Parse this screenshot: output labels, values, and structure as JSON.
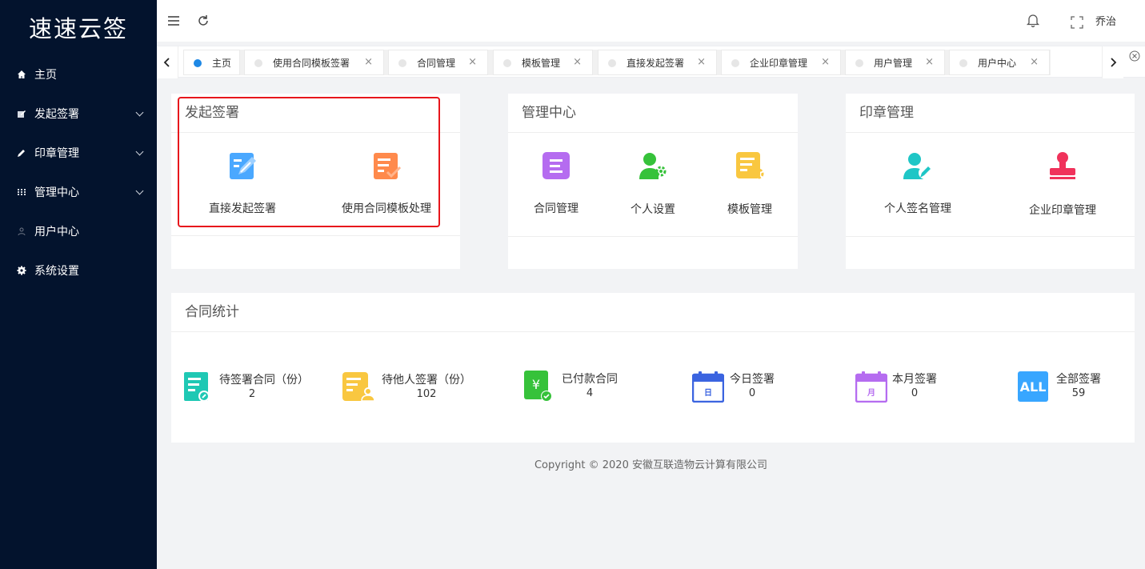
{
  "app": {
    "logo": "速速云签"
  },
  "sidebar": {
    "items": [
      {
        "label": "主页",
        "icon": "home-icon"
      },
      {
        "label": "发起签署",
        "icon": "edit-icon"
      },
      {
        "label": "印章管理",
        "icon": "pen-icon"
      },
      {
        "label": "管理中心",
        "icon": "grid-icon"
      },
      {
        "label": "用户中心",
        "icon": "user-icon"
      },
      {
        "label": "系统设置",
        "icon": "gear-icon"
      }
    ]
  },
  "header": {
    "user_name": "乔治"
  },
  "tabs": [
    {
      "label": "主页",
      "active": true
    },
    {
      "label": "使用合同模板签署"
    },
    {
      "label": "合同管理"
    },
    {
      "label": "模板管理"
    },
    {
      "label": "直接发起签署"
    },
    {
      "label": "企业印章管理"
    },
    {
      "label": "用户管理"
    },
    {
      "label": "用户中心"
    }
  ],
  "cards": {
    "sign": {
      "title": "发起签署",
      "actions": [
        {
          "label": "直接发起签署"
        },
        {
          "label": "使用合同模板处理"
        }
      ]
    },
    "manage": {
      "title": "管理中心",
      "actions": [
        {
          "label": "合同管理"
        },
        {
          "label": "个人设置"
        },
        {
          "label": "模板管理"
        }
      ]
    },
    "seal": {
      "title": "印章管理",
      "actions": [
        {
          "label": "个人签名管理"
        },
        {
          "label": "企业印章管理"
        }
      ]
    }
  },
  "stats": {
    "title": "合同统计",
    "items": [
      {
        "label": "待签署合同（份）",
        "value": "2",
        "icon": "pending-sign-icon"
      },
      {
        "label": "待他人签署（份）",
        "value": "102",
        "icon": "waiting-others-icon"
      },
      {
        "label": "已付款合同",
        "value": "4",
        "icon": "paid-contract-icon",
        "icon_text": "¥"
      },
      {
        "label": "今日签署",
        "value": "0",
        "icon": "calendar-today-icon",
        "icon_text": "日"
      },
      {
        "label": "本月签署",
        "value": "0",
        "icon": "calendar-month-icon",
        "icon_text": "月"
      },
      {
        "label": "全部签署",
        "value": "59",
        "icon": "all-icon",
        "icon_text": "ALL"
      }
    ]
  },
  "footer": {
    "copyright": "Copyright © 2020 安徽互联造物云计算有限公司"
  },
  "colors": {
    "sidebar": "#03132d",
    "active_tab_dot": "#1e88e5",
    "highlight_border": "#e7161c"
  }
}
